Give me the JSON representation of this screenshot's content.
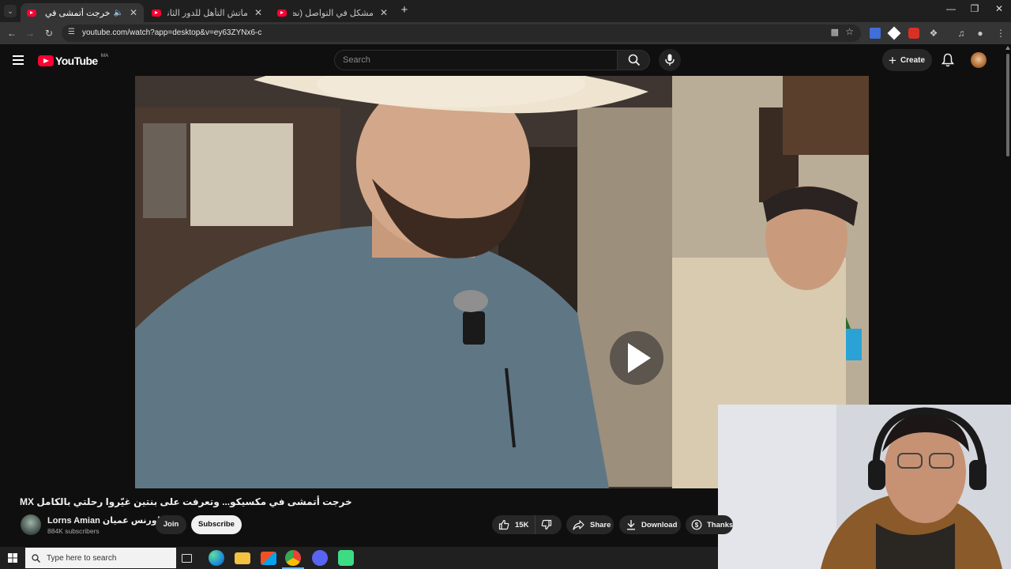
{
  "browser": {
    "tabs": [
      {
        "title": "خرجت أتمشى في مكسيكو...",
        "active": true
      },
      {
        "title": "ماتش التأهل للدور الثاني؟ (التشكيلة",
        "active": false
      },
      {
        "title": "مشكل في التواصل (نظرية البراكة)",
        "active": false
      }
    ],
    "new_tab_label": "+",
    "url": "youtube.com/watch?app=desktop&v=ey63ZYNx6-c"
  },
  "youtube": {
    "logo_text": "YouTube",
    "logo_region": "MA",
    "search_placeholder": "Search",
    "create_label": "Create"
  },
  "video": {
    "title": "خرجت أتمشى في مكسيكو... وتعرفت على بنتين غيّروا رحلتي بالكامل MX",
    "channel_name": "Lorns Amian لورنس عميان",
    "subscribers": "884K subscribers",
    "join_label": "Join",
    "subscribe_label": "Subscribe",
    "likes": "15K",
    "share_label": "Share",
    "download_label": "Download",
    "thanks_label": "Thanks"
  },
  "taskbar": {
    "search_placeholder": "Type here to search"
  },
  "colors": {
    "youtube_red": "#ff0033",
    "background": "#0f0f0f",
    "pill": "#272727"
  }
}
